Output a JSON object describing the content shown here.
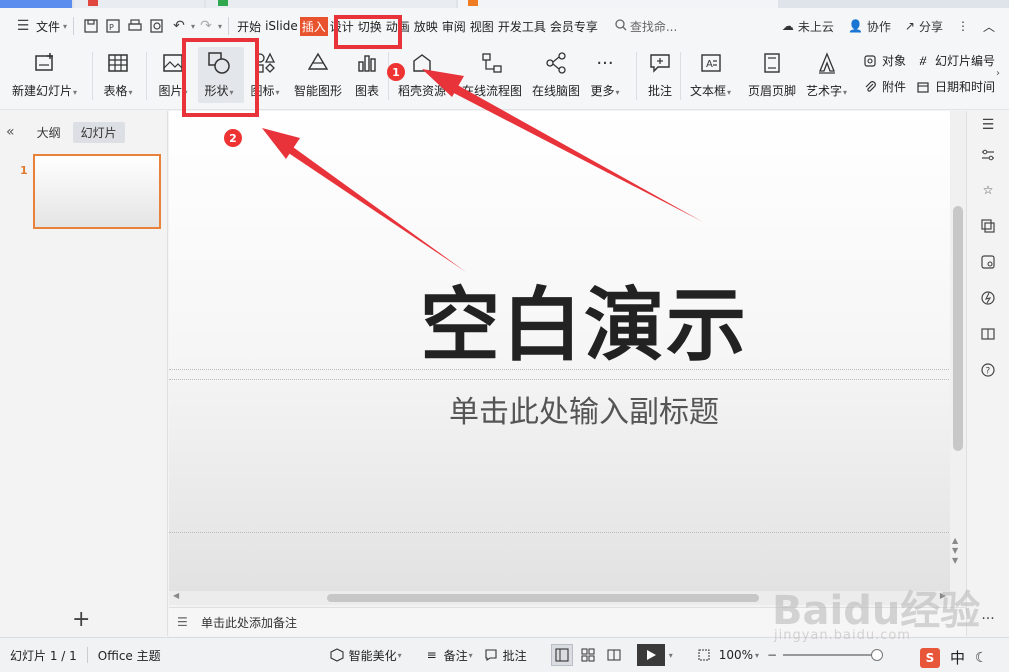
{
  "menubar": {
    "file_label": "文件",
    "tabs": [
      "开始",
      "iSlide",
      "插入",
      "设计",
      "切换",
      "动画",
      "放映",
      "审阅",
      "视图",
      "开发工具",
      "会员专享"
    ],
    "active_tab": "插入",
    "search_placeholder": "查找命...",
    "cloud_label": "未上云",
    "collab_label": "协作",
    "share_label": "分享"
  },
  "ribbon": {
    "new_slide": "新建幻灯片",
    "table": "表格",
    "picture": "图片",
    "shape": "形状",
    "icon": "图标",
    "smartart": "智能图形",
    "chart": "图表",
    "docer": "稻壳资源",
    "flowchart": "在线流程图",
    "mindmap": "在线脑图",
    "more": "更多",
    "comment": "批注",
    "textbox": "文本框",
    "header_footer": "页眉页脚",
    "wordart": "艺术字",
    "object": "对象",
    "slide_number": "幻灯片编号",
    "attachment": "附件",
    "date_time": "日期和时间"
  },
  "leftpanel": {
    "tab_outline": "大纲",
    "tab_slides": "幻灯片",
    "slide_number": "1"
  },
  "slide": {
    "title": "空白演示",
    "subtitle": "单击此处输入副标题"
  },
  "notes": {
    "placeholder": "单击此处添加备注"
  },
  "statusbar": {
    "slide_info": "幻灯片 1 / 1",
    "theme": "Office 主题",
    "beautify": "智能美化",
    "notes": "备注",
    "comment": "批注",
    "zoom": "100%"
  },
  "annotations": [
    "1",
    "2"
  ],
  "watermark": {
    "main": "Baidu经验",
    "sub": "jingyan.baidu.com"
  },
  "ime": {
    "logo": "S",
    "mode": "中"
  },
  "colors": {
    "accent": "#e8522d",
    "annotation": "#e8333a",
    "thumb_border": "#e8813a"
  }
}
